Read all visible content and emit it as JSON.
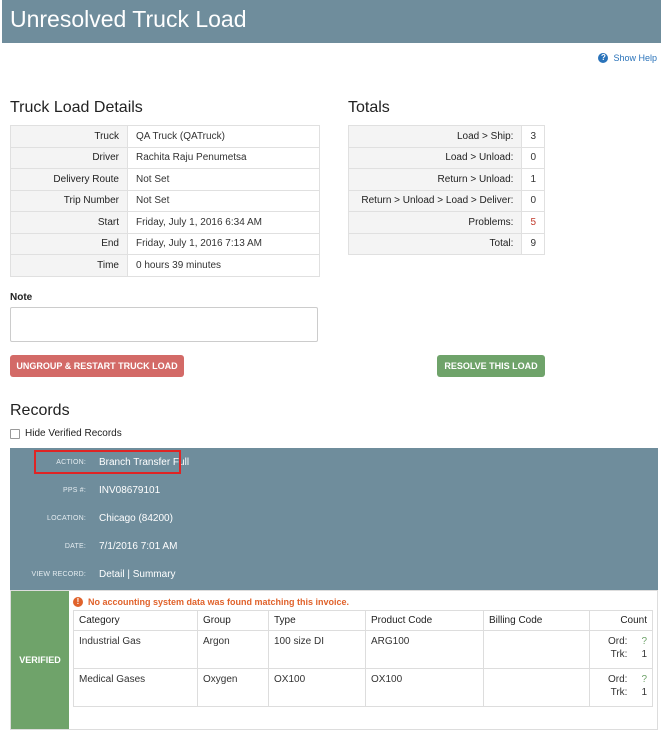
{
  "header": {
    "title": "Unresolved Truck Load"
  },
  "help": {
    "label": "Show Help"
  },
  "details": {
    "title": "Truck Load Details",
    "rows": [
      {
        "label": "Truck",
        "value": "QA Truck (QATruck)"
      },
      {
        "label": "Driver",
        "value": "Rachita Raju Penumetsa"
      },
      {
        "label": "Delivery Route",
        "value": "Not Set"
      },
      {
        "label": "Trip Number",
        "value": "Not Set"
      },
      {
        "label": "Start",
        "value": "Friday, July 1, 2016 6:34 AM"
      },
      {
        "label": "End",
        "value": "Friday, July 1, 2016 7:13 AM"
      },
      {
        "label": "Time",
        "value": "0 hours 39 minutes"
      }
    ]
  },
  "totals": {
    "title": "Totals",
    "rows": [
      {
        "label": "Load > Ship:",
        "value": "3"
      },
      {
        "label": "Load > Unload:",
        "value": "0"
      },
      {
        "label": "Return > Unload:",
        "value": "1"
      },
      {
        "label": "Return > Unload > Load > Deliver:",
        "value": "0"
      },
      {
        "label": "Problems:",
        "value": "5"
      },
      {
        "label": "Total:",
        "value": "9"
      }
    ],
    "problem_color": "#c0392b"
  },
  "note": {
    "label": "Note",
    "value": ""
  },
  "buttons": {
    "ungroup": "UNGROUP & RESTART TRUCK LOAD",
    "resolve": "RESOLVE THIS LOAD"
  },
  "records": {
    "title": "Records",
    "hide_verified": "Hide Verified Records",
    "action_label": "ACTION:",
    "action_value": "Branch Transfer Full",
    "pps_label": "PPS #:",
    "pps_value": "INV08679101",
    "location_label": "LOCATION:",
    "location_value": "Chicago (84200)",
    "date_label": "DATE:",
    "date_value": "7/1/2016 7:01 AM",
    "view_label": "VIEW RECORD:",
    "view_detail": "Detail",
    "view_sep": " | ",
    "view_summary": "Summary",
    "status": "VERIFIED",
    "warning": "No accounting system data was found matching this invoice.",
    "columns": [
      "Category",
      "Group",
      "Type",
      "Product Code",
      "Billing Code",
      "Count"
    ],
    "ord_label": "Ord:",
    "trk_label": "Trk:",
    "items": [
      {
        "category": "Industrial Gas",
        "group": "Argon",
        "type": "100 size DI",
        "product_code": "ARG100",
        "billing_code": "",
        "ord": "?",
        "trk": "1"
      },
      {
        "category": "Medical Gases",
        "group": "Oxygen",
        "type": "OX100",
        "product_code": "OX100",
        "billing_code": "",
        "ord": "?",
        "trk": "1"
      }
    ]
  },
  "colors": {
    "header": "#6f8d9c",
    "danger": "#d36a67",
    "success": "#6fa36a",
    "link": "#2a73ba",
    "warning": "#e0622b"
  }
}
